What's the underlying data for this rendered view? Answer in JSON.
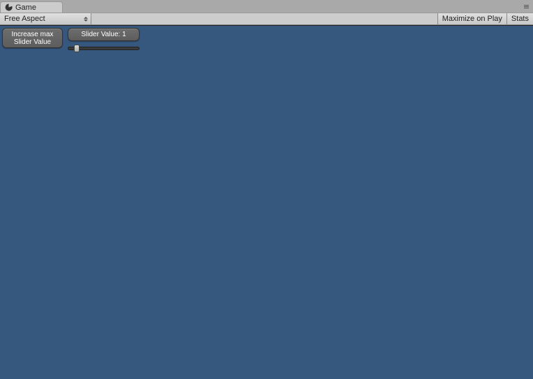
{
  "tab": {
    "label": "Game"
  },
  "toolbar": {
    "aspect": "Free Aspect",
    "maximize": "Maximize on Play",
    "stats": "Stats"
  },
  "ui": {
    "increase_button": "Increase max\nSlider Value",
    "slider_label": "Slider Value: 1"
  },
  "colors": {
    "viewport_bg": "#36577e",
    "editor_bg": "#a9a9a9"
  }
}
